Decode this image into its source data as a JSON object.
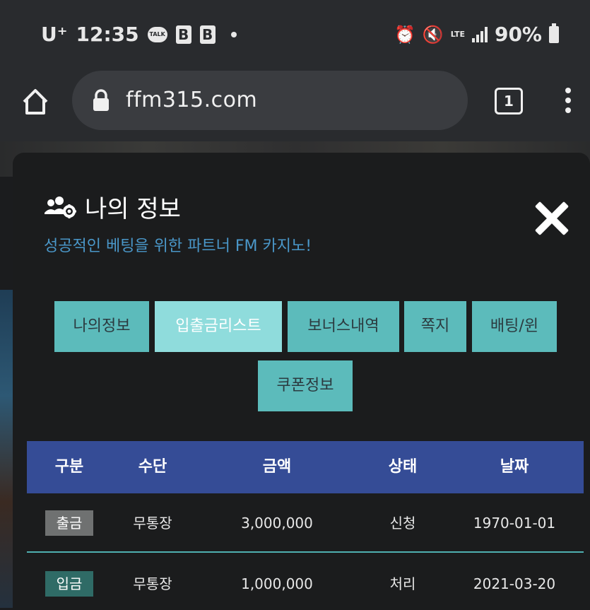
{
  "status_bar": {
    "carrier": "U⁺",
    "time": "12:35",
    "talk_label": "TALK",
    "b_icon_label": "B",
    "network": "LTE",
    "battery": "90%"
  },
  "browser": {
    "url": "ffm315.com",
    "tab_count": "1"
  },
  "modal": {
    "title": "나의 정보",
    "subtitle": "성공적인 베팅을 위한 파트너 FM 카지노!",
    "tabs": [
      {
        "label": "나의정보"
      },
      {
        "label": "입출금리스트",
        "active": true
      },
      {
        "label": "보너스내역"
      },
      {
        "label": "쪽지"
      },
      {
        "label": "배팅/윈"
      },
      {
        "label": "쿠폰정보"
      }
    ],
    "table": {
      "headers": [
        "구분",
        "수단",
        "금액",
        "상태",
        "날짜"
      ],
      "rows": [
        {
          "type": "출금",
          "method": "무통장",
          "amount": "3,000,000",
          "status": "신청",
          "date": "1970-01-01",
          "badge_color": "#6f7171"
        },
        {
          "type": "입금",
          "method": "무통장",
          "amount": "1,000,000",
          "status": "처리",
          "date": "2021-03-20",
          "badge_color": "#2f6b66"
        }
      ]
    }
  },
  "colors": {
    "accent_tab": "#5cbbbb",
    "active_tab": "#8fdcdc",
    "table_header": "#354c96",
    "subtitle": "#4a97c9"
  }
}
